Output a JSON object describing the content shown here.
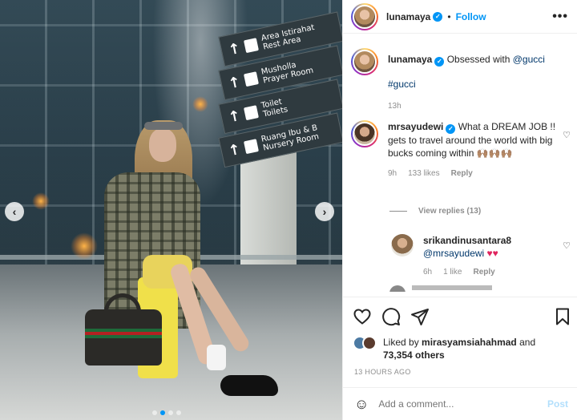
{
  "post": {
    "author": "lunamaya",
    "follow_label": "Follow",
    "separator": "•",
    "more_label": "•••"
  },
  "photo": {
    "signs": [
      {
        "line1": "Area Istirahat",
        "line2": "Rest Area"
      },
      {
        "line1": "Musholla",
        "line2": "Prayer Room"
      },
      {
        "line1": "Toilet",
        "line2": "Toilets"
      },
      {
        "line1": "Ruang Ibu & B",
        "line2": "Nursery Room"
      }
    ],
    "prev_label": "‹",
    "next_label": "›",
    "carousel_count": 4,
    "carousel_active": 1
  },
  "caption": {
    "username": "lunamaya",
    "text": "Obsessed with ",
    "mention": "@gucci",
    "hashtag": "#gucci",
    "age": "13h"
  },
  "comments": [
    {
      "username": "mrsayudewi",
      "text": "What a DREAM JOB !! gets to travel around the world with big bucks coming within 🙌🏽🙌🏽🙌🏽",
      "age": "9h",
      "likes": "133 likes",
      "reply_label": "Reply"
    }
  ],
  "view_replies": "View replies (13)",
  "reply": {
    "username": "srikandinusantara8",
    "mention": "@mrsayudewi",
    "hearts": "♥♥",
    "age": "6h",
    "likes": "1 like",
    "reply_label": "Reply"
  },
  "likes": {
    "liked_by_prefix": "Liked by ",
    "liked_by_user": "mirasyamsiahahmad",
    "and": " and",
    "others": "73,354 others"
  },
  "timestamp": "13 HOURS AGO",
  "add_comment": {
    "placeholder": "Add a comment...",
    "post_label": "Post",
    "emoji_label": "☺"
  },
  "colors": {
    "accent": "#0095f6",
    "heart": "#e0245e"
  }
}
